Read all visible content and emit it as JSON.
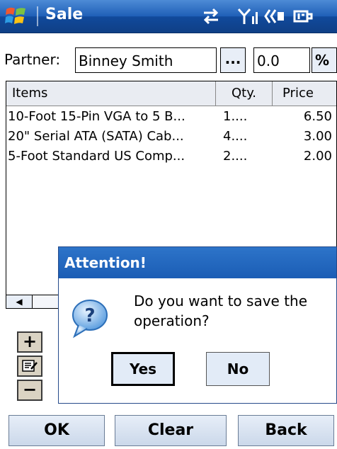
{
  "titlebar": {
    "title": "Sale"
  },
  "form": {
    "partner_label": "Partner:",
    "partner_value": "Binney  Smith",
    "browse_label": "...",
    "discount_value": "0.0",
    "percent_label": "%"
  },
  "grid": {
    "headers": {
      "items": "Items",
      "qty": "Qty.",
      "price": "Price"
    },
    "rows": [
      {
        "item": "10-Foot 15-Pin VGA to 5 B...",
        "qty": "1....",
        "price": "6.50"
      },
      {
        "item": "20\" Serial ATA (SATA) Cab...",
        "qty": "4....",
        "price": "3.00"
      },
      {
        "item": "5-Foot Standard US Comp...",
        "qty": "2....",
        "price": "2.00"
      }
    ]
  },
  "side_buttons": {
    "add": "+",
    "remove": "−"
  },
  "dialog": {
    "title": "Attention!",
    "message": "Do you want to save the operation?",
    "yes": "Yes",
    "no": "No"
  },
  "bottom": {
    "ok": "OK",
    "clear": "Clear",
    "back": "Back"
  },
  "colors": {
    "titlebar": "#1f5fb7",
    "dialog_title": "#2d74c9",
    "button_face": "#e2ebf7",
    "side_button_face": "#dad3c3"
  },
  "icons": {
    "start": "windows-flag-icon",
    "connectivity": "sync-arrows-icon",
    "signal": "signal-strength-icon",
    "volume": "speaker-icon",
    "battery": "battery-plug-icon",
    "dialog": "question-bubble-icon",
    "edit": "edit-notepad-icon",
    "scroll_left": "left-arrow-icon"
  }
}
